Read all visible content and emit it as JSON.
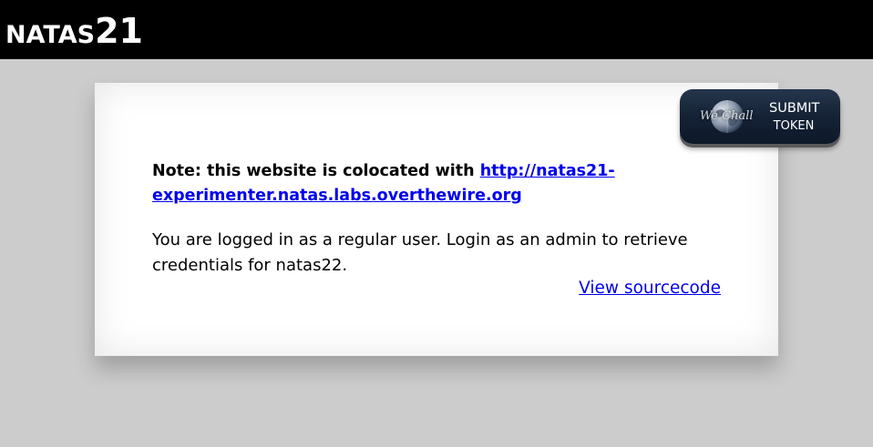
{
  "header": {
    "title_prefix": "NATAS",
    "title_number": "21"
  },
  "wechall": {
    "logo_text": "We Chall",
    "submit_line1": "SUBMIT",
    "submit_line2": "TOKEN"
  },
  "content": {
    "note_prefix": "Note: this website is colocated with ",
    "note_link_line1": "http://natas21-",
    "note_link_line2": "experimenter.natas.labs.overthewire.org",
    "message": "You are logged in as a regular user. Login as an admin to retrieve credentials for natas22.",
    "view_source_label": "View sourcecode"
  },
  "colors": {
    "banner_bg": "#000000",
    "page_bg": "#cccccc",
    "link": "#0000ee",
    "button_bg": "#152236"
  }
}
